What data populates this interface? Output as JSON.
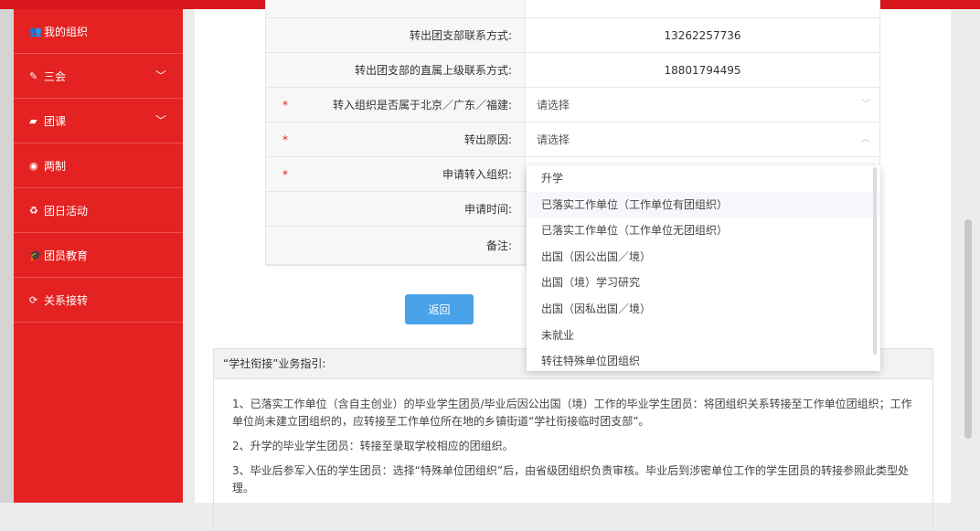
{
  "sidebar": {
    "items": [
      {
        "label": "我的组织",
        "icon": "users-icon",
        "chev": false
      },
      {
        "label": "三会",
        "icon": "edit-icon",
        "chev": true
      },
      {
        "label": "团课",
        "icon": "folder-icon",
        "chev": true
      },
      {
        "label": "两制",
        "icon": "target-icon",
        "chev": false
      },
      {
        "label": "团日活动",
        "icon": "recycle-icon",
        "chev": false
      },
      {
        "label": "团员教育",
        "icon": "graduation-cap-icon",
        "chev": false
      },
      {
        "label": "关系接转",
        "icon": "refresh-icon",
        "chev": false
      }
    ]
  },
  "form": {
    "rows": [
      {
        "label": "转出团支部联系方式:",
        "value": "13262257736"
      },
      {
        "label": "转出团支部的直属上级联系方式:",
        "value": "18801794495"
      },
      {
        "label": "转入组织是否属于北京／广东／福建:",
        "value": "请选择",
        "required": "*"
      },
      {
        "label": "转出原因:",
        "value": "请选择",
        "required": "*"
      },
      {
        "label": "申请转入组织:",
        "value": "",
        "required": "*"
      },
      {
        "label": "申请时间:",
        "value": ""
      },
      {
        "label": "备注:",
        "value": ""
      }
    ]
  },
  "back_button": "返回",
  "dropdown": {
    "options": [
      "升学",
      "已落实工作单位（工作单位有团组织）",
      "已落实工作单位（工作单位无团组织）",
      "出国（因公出国／境）",
      "出国（境）学习研究",
      "出国（因私出国／境）",
      "未就业",
      "转往特殊单位团组织"
    ]
  },
  "guide": {
    "title": "“学社衔接”业务指引:",
    "paragraphs": [
      "1、已落实工作单位（含自主创业）的毕业学生团员/毕业后因公出国（境）工作的毕业学生团员：将团组织关系转接至工作单位团组织；工作单位尚未建立团组织的，应转接至工作单位所在地的乡镇街道“学社衔接临时团支部”。",
      "2、升学的毕业学生团员：转接至录取学校相应的团组织。",
      "3、毕业后参军入伍的学生团员：选择“特殊单位团组织”后，由省级团组织负责审核。毕业后到涉密单位工作的学生团员的转接参照此类型处理。"
    ]
  }
}
